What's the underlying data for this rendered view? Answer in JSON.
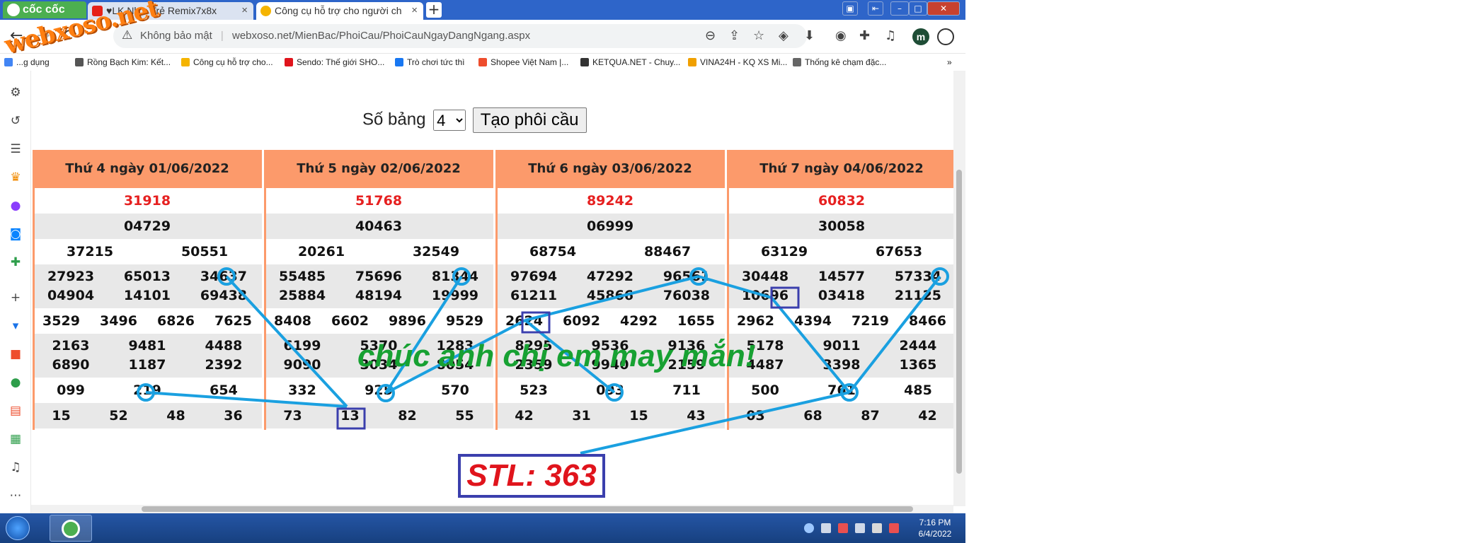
{
  "browser": {
    "brand": "cốc cốc",
    "tabs": [
      {
        "label": "♥LK Nh... Trẻ Remix7x8x",
        "icon": "youtube-icon"
      },
      {
        "label": "Công cụ hỗ trợ cho người ch",
        "icon": "xs-favicon"
      }
    ],
    "new_tab": "+",
    "insecure_label": "Không bảo mật",
    "url": "webxoso.net/MienBac/PhoiCau/PhoiCauNgayDangNgang.aspx",
    "profile_initial": "m",
    "bookmarks": [
      {
        "label": "...g dụng",
        "color": "#4285f4"
      },
      {
        "label": "Rồng Bạch Kim: Kết...",
        "color": "#555555"
      },
      {
        "label": "Công cụ hỗ trợ cho...",
        "color": "#f5b400"
      },
      {
        "label": "Sendo: Thế giới SHO...",
        "color": "#e0141c"
      },
      {
        "label": "Trò chơi tức thì",
        "color": "#1877f2"
      },
      {
        "label": "Shopee Việt Nam |...",
        "color": "#ee4d2d"
      },
      {
        "label": "KETQUA.NET - Chuy...",
        "color": "#333333"
      },
      {
        "label": "VINA24H - KQ XS Mi...",
        "color": "#f0a000"
      },
      {
        "label": "Thống kê chạm đặc...",
        "color": "#666666"
      }
    ],
    "bookmarks_more": "»"
  },
  "watermark": "webxoso.net",
  "controls": {
    "label": "Số bảng",
    "select_value": "4",
    "button_label": "Tạo phôi cầu"
  },
  "tables": [
    {
      "title": "Thứ 4 ngày 01/06/2022",
      "db": "31918",
      "g1": "04729",
      "g2": [
        "37215",
        "50551"
      ],
      "g3": [
        "27923",
        "65013",
        "34637",
        "04904",
        "14101",
        "69438"
      ],
      "g4": [
        "3529",
        "3496",
        "6826",
        "7625"
      ],
      "g5": [
        "2163",
        "9481",
        "4488",
        "6890",
        "1187",
        "2392"
      ],
      "g6": [
        "099",
        "219",
        "654"
      ],
      "g7": [
        "15",
        "52",
        "48",
        "36"
      ]
    },
    {
      "title": "Thứ 5 ngày 02/06/2022",
      "db": "51768",
      "g1": "40463",
      "g2": [
        "20261",
        "32549"
      ],
      "g3": [
        "55485",
        "75696",
        "81344",
        "25884",
        "48194",
        "19999"
      ],
      "g4": [
        "8408",
        "6602",
        "9896",
        "9529"
      ],
      "g5": [
        "6199",
        "5370",
        "1283",
        "9090",
        "3034",
        "8054"
      ],
      "g6": [
        "332",
        "925",
        "570"
      ],
      "g7": [
        "73",
        "13",
        "82",
        "55"
      ]
    },
    {
      "title": "Thứ 6 ngày 03/06/2022",
      "db": "89242",
      "g1": "06999",
      "g2": [
        "68754",
        "88467"
      ],
      "g3": [
        "97694",
        "47292",
        "96561",
        "61211",
        "45866",
        "76038"
      ],
      "g4": [
        "2624",
        "6092",
        "4292",
        "1655"
      ],
      "g5": [
        "8295",
        "9536",
        "9136",
        "2359",
        "9940",
        "2159"
      ],
      "g6": [
        "523",
        "093",
        "711"
      ],
      "g7": [
        "42",
        "31",
        "15",
        "43"
      ]
    },
    {
      "title": "Thứ 7 ngày 04/06/2022",
      "db": "60832",
      "g1": "30058",
      "g2": [
        "63129",
        "67653"
      ],
      "g3": [
        "30448",
        "14577",
        "57334",
        "10696",
        "03418",
        "21125"
      ],
      "g4": [
        "2962",
        "4394",
        "7219",
        "8466"
      ],
      "g5": [
        "5178",
        "9011",
        "2444",
        "4487",
        "3398",
        "1365"
      ],
      "g6": [
        "500",
        "761",
        "485"
      ],
      "g7": [
        "03",
        "68",
        "87",
        "42"
      ]
    }
  ],
  "annotations": {
    "wish": "chúc anh chị em may mắn!",
    "stl": "STL: 363",
    "line_color": "#1aa0e0",
    "box_color": "#3b3fad"
  },
  "taskbar": {
    "time": "7:16 PM",
    "date": "6/4/2022"
  }
}
